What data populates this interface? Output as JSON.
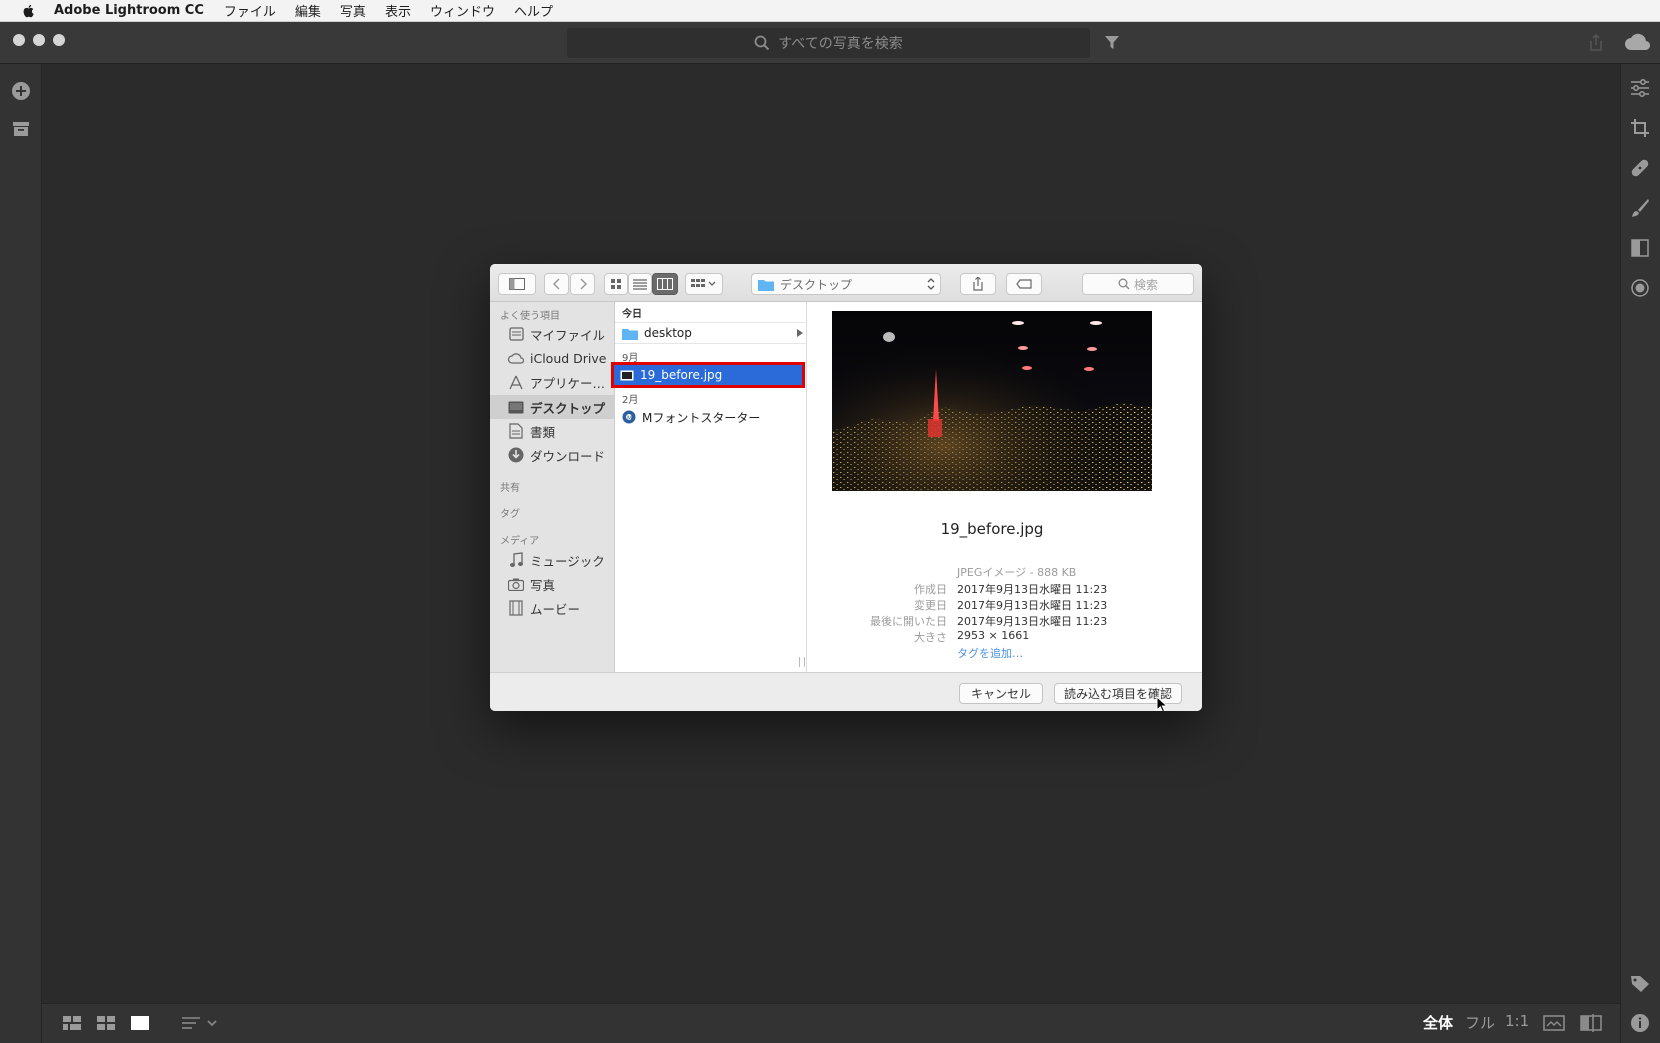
{
  "menubar": {
    "app": "Adobe Lightroom CC",
    "items": [
      "ファイル",
      "編集",
      "写真",
      "表示",
      "ウィンドウ",
      "ヘルプ"
    ]
  },
  "titlebar": {
    "search_placeholder": "すべての写真を検索"
  },
  "bottombar": {
    "view_labels": [
      "全体",
      "フル",
      "1:1"
    ]
  },
  "dialog": {
    "path": "デスクトップ",
    "search_placeholder": "検索",
    "sidebar": {
      "favorites_header": "よく使う項目",
      "favorites": [
        {
          "label": "マイファイル",
          "icon": "all-files-icon"
        },
        {
          "label": "iCloud Drive",
          "icon": "cloud-icon"
        },
        {
          "label": "アプリケー…",
          "icon": "applications-icon"
        },
        {
          "label": "デスクトップ",
          "icon": "desktop-icon",
          "selected": true
        },
        {
          "label": "書類",
          "icon": "documents-icon"
        },
        {
          "label": "ダウンロード",
          "icon": "downloads-icon"
        }
      ],
      "shared_header": "共有",
      "tags_header": "タグ",
      "media_header": "メディア",
      "media": [
        {
          "label": "ミュージック",
          "icon": "music-icon"
        },
        {
          "label": "写真",
          "icon": "camera-icon"
        },
        {
          "label": "ムービー",
          "icon": "film-icon"
        }
      ]
    },
    "files": {
      "group_today": "今日",
      "folder": "desktop",
      "group_sep": "9月",
      "selected_file": "19_before.jpg",
      "group_feb": "2月",
      "app_file": "Mフォントスターター"
    },
    "preview": {
      "filename": "19_before.jpg",
      "kind": "JPEGイメージ - 888 KB",
      "created_label": "作成日",
      "created": "2017年9月13日水曜日 11:23",
      "modified_label": "変更日",
      "modified": "2017年9月13日水曜日 11:23",
      "opened_label": "最後に開いた日",
      "opened": "2017年9月13日水曜日 11:23",
      "size_label": "大きさ",
      "size": "2953 × 1661",
      "add_tag": "タグを追加…"
    },
    "buttons": {
      "cancel": "キャンセル",
      "confirm": "読み込む項目を確認"
    },
    "colors": {
      "selection": "#2b6bd9",
      "highlight_box": "#e00000"
    }
  }
}
